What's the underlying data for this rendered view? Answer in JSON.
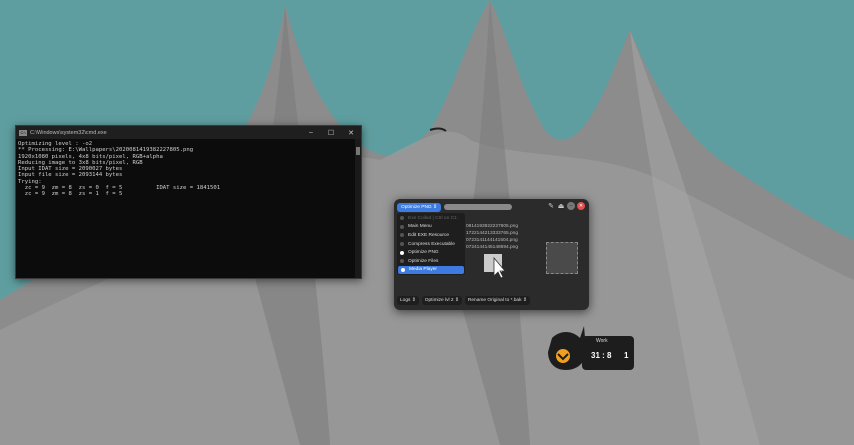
{
  "colors": {
    "sky": "#5f9ea0",
    "accent": "#3d7be0",
    "cmd_bg": "#0c0c0c"
  },
  "cmd": {
    "title": "C:\\Windows\\system32\\cmd.exe",
    "lines": [
      "Optimizing level : -o2",
      "** Processing: E:\\Wallpapers\\2020081419382227805.png",
      "1920x1080 pixels, 4x8 bits/pixel, RGB+alpha",
      "Reducing image to 3x8 bits/pixel, RGB",
      "Input IDAT size = 2090027 bytes",
      "Input file size = 2093144 bytes",
      "",
      "Trying:",
      "  zc = 9  zm = 8  zs = 0  f = 5          IDAT size = 1841501",
      "  zc = 9  zm = 8  zs = 1  f = 5"
    ]
  },
  "optimizer": {
    "mode_select": "Optimize PNG ⇕",
    "menu": [
      {
        "label": "Exe Coiled | Ctrl on C1:",
        "state": "disabled"
      },
      {
        "label": "Main Menu",
        "state": "normal"
      },
      {
        "label": "Edit EXE Resource",
        "state": "normal"
      },
      {
        "label": "Compress Executable",
        "state": "normal"
      },
      {
        "label": "Optimize PNG",
        "state": "checked"
      },
      {
        "label": "Optimize Files",
        "state": "normal"
      },
      {
        "label": "Media Player",
        "state": "active"
      }
    ],
    "files": [
      "0814193822227805.png",
      "1722144213333765.png",
      "0723141144141504.png",
      "0724144145148694.png"
    ],
    "bottom": {
      "logs": "Logs ⇕",
      "level": "Optimize lvl 2 ⇕",
      "rename": "Rename Original to *.bak ⇕"
    }
  },
  "work": {
    "label": "Work",
    "time": "31 : 8",
    "count": "1"
  }
}
